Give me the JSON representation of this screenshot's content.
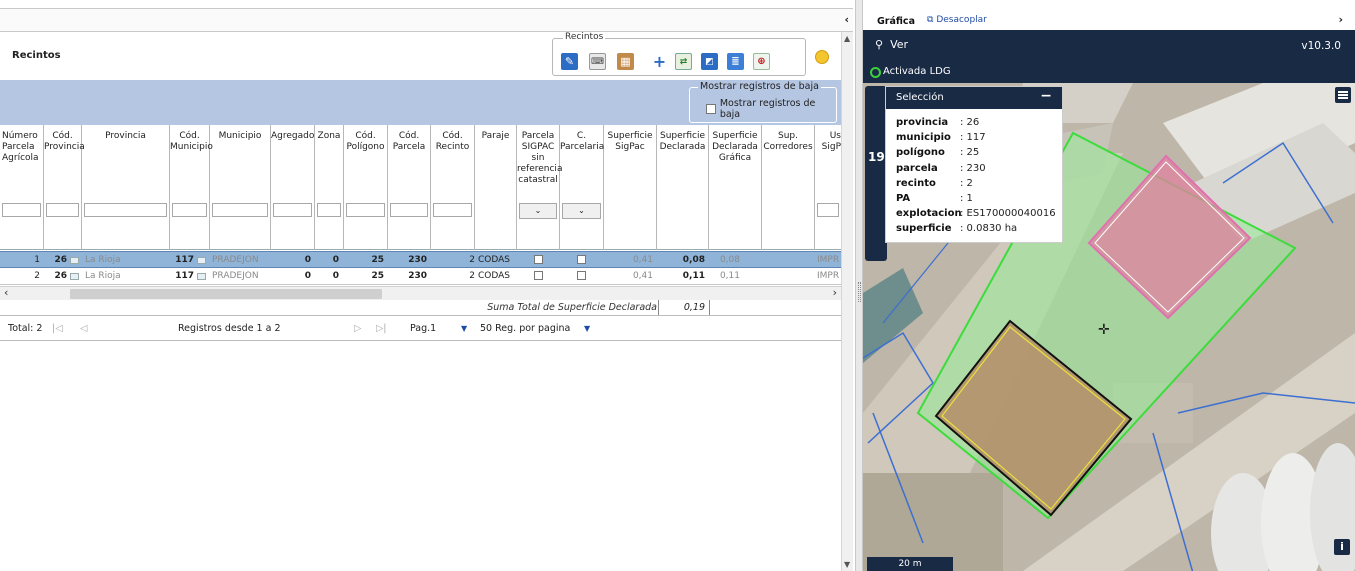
{
  "left": {
    "title": "Recintos",
    "collapse_glyph": "‹",
    "toolgroup_label": "Recintos",
    "baja": {
      "group_label": "Mostrar registros de baja",
      "check_label": "Mostrar registros de baja"
    },
    "columns": [
      "Número Parcela Agrícola",
      "Cód. Provincia",
      "Provincia",
      "Cód. Municipio",
      "Municipio",
      "Agregado",
      "Zona",
      "Cód. Polígono",
      "Cód. Parcela",
      "Cód. Recinto",
      "Paraje",
      "Parcela SIGPAC sin referencia catastral",
      "C. Parcelaria",
      "Superficie SigPac",
      "Superficie Declarada",
      "Superficie Declarada Gráfica",
      "Sup. Corredores",
      "Us SigP"
    ],
    "select_glyph": "⌄",
    "rows": [
      {
        "num": "1",
        "cprov": "26",
        "prov": "La Rioja",
        "cmun": "117",
        "mun": "PRADEJON",
        "agr": "0",
        "zona": "0",
        "pol": "25",
        "par": "230",
        "rec": "2",
        "paraje": "CODAS",
        "sigpac": "0,41",
        "decl": "0,08",
        "grafica": "0,08",
        "uso": "IMPR"
      },
      {
        "num": "2",
        "cprov": "26",
        "prov": "La Rioja",
        "cmun": "117",
        "mun": "PRADEJON",
        "agr": "0",
        "zona": "0",
        "pol": "25",
        "par": "230",
        "rec": "2",
        "paraje": "CODAS",
        "sigpac": "0,41",
        "decl": "0,11",
        "grafica": "0,11",
        "uso": "IMPR"
      }
    ],
    "sum_label": "Suma Total de Superficie Declarada",
    "sum_value": "0,19",
    "pager": {
      "total": "Total: 2",
      "first": "|◁",
      "prev": "◁",
      "range": "Registros desde 1 a 2",
      "next": "▷",
      "last": "▷|",
      "page": "Pag.1",
      "page_caret": "▼",
      "per_page": "50 Reg. por pagina",
      "per_caret": "▼"
    }
  },
  "right": {
    "tab": "Gráfica",
    "detach": "Desacoplar",
    "chevron": "›",
    "ver_label": "Ver",
    "version": "v10.3.0",
    "ldg": "Activada LDG",
    "badge": "19",
    "selection": {
      "title": "Selección",
      "min": "−",
      "items": [
        {
          "k": "provincia",
          "v": ": 26"
        },
        {
          "k": "municipio",
          "v": ": 117"
        },
        {
          "k": "polígono",
          "v": ": 25"
        },
        {
          "k": "parcela",
          "v": ": 230"
        },
        {
          "k": "recinto",
          "v": ": 2"
        },
        {
          "k": "PA",
          "v": ": 1"
        },
        {
          "k": "explotacion",
          "v": ": ES170000040016"
        },
        {
          "k": "superficie",
          "v": ": 0.0830 ha"
        }
      ]
    },
    "scale": "20 m",
    "info": "i"
  },
  "icons": [
    "edit-icon",
    "keyboard-icon",
    "map-icon",
    "add-icon",
    "split-icon",
    "draw-icon",
    "list-icon",
    "zoom-icon",
    "gold-circle-icon",
    "hamburger-icon",
    "info-icon",
    "crosshair-icon"
  ],
  "colors": {
    "nav_dark": "#192a45",
    "row_selected": "#8fb4d8",
    "band": "#b5c6e2",
    "parcel_green": "#3ddc3d",
    "pink": "#e070b0",
    "brown": "#b48c69"
  }
}
